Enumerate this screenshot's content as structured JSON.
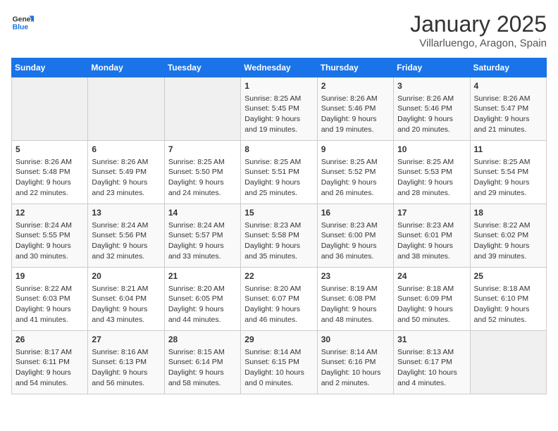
{
  "header": {
    "logo_line1": "General",
    "logo_line2": "Blue",
    "title": "January 2025",
    "subtitle": "Villarluengo, Aragon, Spain"
  },
  "days_of_week": [
    "Sunday",
    "Monday",
    "Tuesday",
    "Wednesday",
    "Thursday",
    "Friday",
    "Saturday"
  ],
  "weeks": [
    [
      {
        "day": "",
        "info": ""
      },
      {
        "day": "",
        "info": ""
      },
      {
        "day": "",
        "info": ""
      },
      {
        "day": "1",
        "info": "Sunrise: 8:25 AM\nSunset: 5:45 PM\nDaylight: 9 hours\nand 19 minutes."
      },
      {
        "day": "2",
        "info": "Sunrise: 8:26 AM\nSunset: 5:46 PM\nDaylight: 9 hours\nand 19 minutes."
      },
      {
        "day": "3",
        "info": "Sunrise: 8:26 AM\nSunset: 5:46 PM\nDaylight: 9 hours\nand 20 minutes."
      },
      {
        "day": "4",
        "info": "Sunrise: 8:26 AM\nSunset: 5:47 PM\nDaylight: 9 hours\nand 21 minutes."
      }
    ],
    [
      {
        "day": "5",
        "info": "Sunrise: 8:26 AM\nSunset: 5:48 PM\nDaylight: 9 hours\nand 22 minutes."
      },
      {
        "day": "6",
        "info": "Sunrise: 8:26 AM\nSunset: 5:49 PM\nDaylight: 9 hours\nand 23 minutes."
      },
      {
        "day": "7",
        "info": "Sunrise: 8:25 AM\nSunset: 5:50 PM\nDaylight: 9 hours\nand 24 minutes."
      },
      {
        "day": "8",
        "info": "Sunrise: 8:25 AM\nSunset: 5:51 PM\nDaylight: 9 hours\nand 25 minutes."
      },
      {
        "day": "9",
        "info": "Sunrise: 8:25 AM\nSunset: 5:52 PM\nDaylight: 9 hours\nand 26 minutes."
      },
      {
        "day": "10",
        "info": "Sunrise: 8:25 AM\nSunset: 5:53 PM\nDaylight: 9 hours\nand 28 minutes."
      },
      {
        "day": "11",
        "info": "Sunrise: 8:25 AM\nSunset: 5:54 PM\nDaylight: 9 hours\nand 29 minutes."
      }
    ],
    [
      {
        "day": "12",
        "info": "Sunrise: 8:24 AM\nSunset: 5:55 PM\nDaylight: 9 hours\nand 30 minutes."
      },
      {
        "day": "13",
        "info": "Sunrise: 8:24 AM\nSunset: 5:56 PM\nDaylight: 9 hours\nand 32 minutes."
      },
      {
        "day": "14",
        "info": "Sunrise: 8:24 AM\nSunset: 5:57 PM\nDaylight: 9 hours\nand 33 minutes."
      },
      {
        "day": "15",
        "info": "Sunrise: 8:23 AM\nSunset: 5:58 PM\nDaylight: 9 hours\nand 35 minutes."
      },
      {
        "day": "16",
        "info": "Sunrise: 8:23 AM\nSunset: 6:00 PM\nDaylight: 9 hours\nand 36 minutes."
      },
      {
        "day": "17",
        "info": "Sunrise: 8:23 AM\nSunset: 6:01 PM\nDaylight: 9 hours\nand 38 minutes."
      },
      {
        "day": "18",
        "info": "Sunrise: 8:22 AM\nSunset: 6:02 PM\nDaylight: 9 hours\nand 39 minutes."
      }
    ],
    [
      {
        "day": "19",
        "info": "Sunrise: 8:22 AM\nSunset: 6:03 PM\nDaylight: 9 hours\nand 41 minutes."
      },
      {
        "day": "20",
        "info": "Sunrise: 8:21 AM\nSunset: 6:04 PM\nDaylight: 9 hours\nand 43 minutes."
      },
      {
        "day": "21",
        "info": "Sunrise: 8:20 AM\nSunset: 6:05 PM\nDaylight: 9 hours\nand 44 minutes."
      },
      {
        "day": "22",
        "info": "Sunrise: 8:20 AM\nSunset: 6:07 PM\nDaylight: 9 hours\nand 46 minutes."
      },
      {
        "day": "23",
        "info": "Sunrise: 8:19 AM\nSunset: 6:08 PM\nDaylight: 9 hours\nand 48 minutes."
      },
      {
        "day": "24",
        "info": "Sunrise: 8:18 AM\nSunset: 6:09 PM\nDaylight: 9 hours\nand 50 minutes."
      },
      {
        "day": "25",
        "info": "Sunrise: 8:18 AM\nSunset: 6:10 PM\nDaylight: 9 hours\nand 52 minutes."
      }
    ],
    [
      {
        "day": "26",
        "info": "Sunrise: 8:17 AM\nSunset: 6:11 PM\nDaylight: 9 hours\nand 54 minutes."
      },
      {
        "day": "27",
        "info": "Sunrise: 8:16 AM\nSunset: 6:13 PM\nDaylight: 9 hours\nand 56 minutes."
      },
      {
        "day": "28",
        "info": "Sunrise: 8:15 AM\nSunset: 6:14 PM\nDaylight: 9 hours\nand 58 minutes."
      },
      {
        "day": "29",
        "info": "Sunrise: 8:14 AM\nSunset: 6:15 PM\nDaylight: 10 hours\nand 0 minutes."
      },
      {
        "day": "30",
        "info": "Sunrise: 8:14 AM\nSunset: 6:16 PM\nDaylight: 10 hours\nand 2 minutes."
      },
      {
        "day": "31",
        "info": "Sunrise: 8:13 AM\nSunset: 6:17 PM\nDaylight: 10 hours\nand 4 minutes."
      },
      {
        "day": "",
        "info": ""
      }
    ]
  ]
}
